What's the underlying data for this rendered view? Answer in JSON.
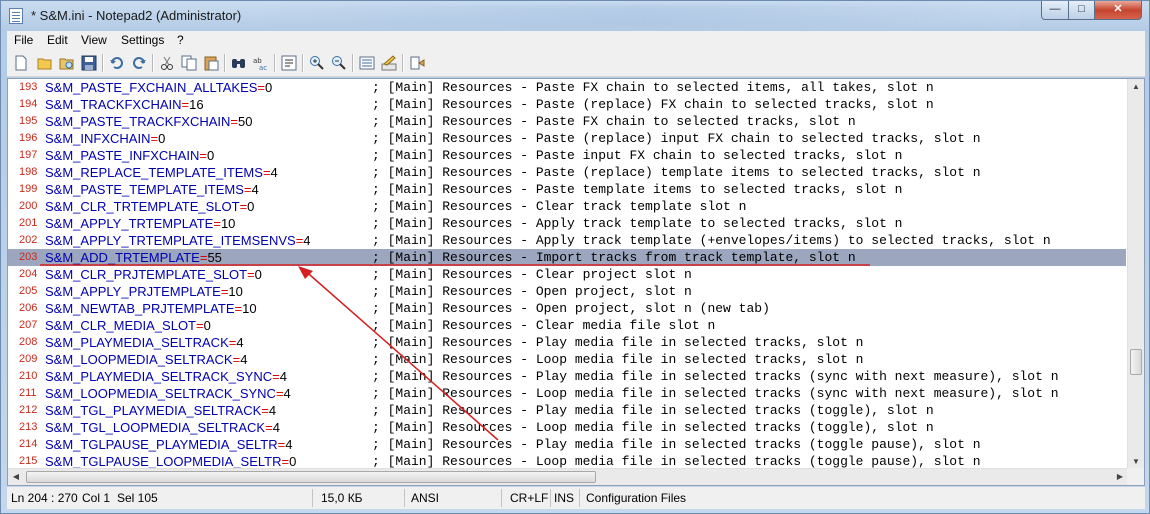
{
  "window": {
    "title": "* S&M.ini - Notepad2 (Administrator)"
  },
  "menu": [
    "File",
    "Edit",
    "View",
    "Settings",
    "?"
  ],
  "toolbar": {
    "buttons": [
      "new-icon",
      "open-icon",
      "browse-icon",
      "save-icon",
      "undo-icon",
      "redo-icon",
      "cut-icon",
      "copy-icon",
      "paste-icon",
      "find-icon",
      "replace-icon",
      "wordwrap-icon",
      "zoom-in-icon",
      "zoom-out-icon",
      "scheme-icon",
      "customize-icon",
      "favorites-icon"
    ]
  },
  "editor": {
    "comment_prefix": ";",
    "lines": [
      {
        "n": "193",
        "key": "S&M_PASTE_FXCHAIN_ALLTAKES",
        "val": "0",
        "comment": "; [Main] Resources - Paste FX chain to selected items, all takes, slot n"
      },
      {
        "n": "194",
        "key": "S&M_TRACKFXCHAIN",
        "val": "16",
        "comment": "; [Main] Resources - Paste (replace) FX chain to selected tracks, slot n"
      },
      {
        "n": "195",
        "key": "S&M_PASTE_TRACKFXCHAIN",
        "val": "50",
        "comment": "; [Main] Resources - Paste FX chain to selected tracks, slot n"
      },
      {
        "n": "196",
        "key": "S&M_INFXCHAIN",
        "val": "0",
        "comment": "; [Main] Resources - Paste (replace) input FX chain to selected tracks, slot n"
      },
      {
        "n": "197",
        "key": "S&M_PASTE_INFXCHAIN",
        "val": "0",
        "comment": "; [Main] Resources - Paste input FX chain to selected tracks, slot n"
      },
      {
        "n": "198",
        "key": "S&M_REPLACE_TEMPLATE_ITEMS",
        "val": "4",
        "comment": "; [Main] Resources - Paste (replace) template items to selected tracks, slot n"
      },
      {
        "n": "199",
        "key": "S&M_PASTE_TEMPLATE_ITEMS",
        "val": "4",
        "comment": "; [Main] Resources - Paste template items to selected tracks, slot n"
      },
      {
        "n": "200",
        "key": "S&M_CLR_TRTEMPLATE_SLOT",
        "val": "0",
        "comment": "; [Main] Resources - Clear track template slot n"
      },
      {
        "n": "201",
        "key": "S&M_APPLY_TRTEMPLATE",
        "val": "10",
        "comment": "; [Main] Resources - Apply track template to selected tracks, slot n"
      },
      {
        "n": "202",
        "key": "S&M_APPLY_TRTEMPLATE_ITEMSENVS",
        "val": "4",
        "comment": "; [Main] Resources - Apply track template (+envelopes/items) to selected tracks, slot n"
      },
      {
        "n": "203",
        "key": "S&M_ADD_TRTEMPLATE",
        "val": "55",
        "comment": "; [Main] Resources - Import tracks from track template, slot n",
        "selected": true
      },
      {
        "n": "204",
        "key": "S&M_CLR_PRJTEMPLATE_SLOT",
        "val": "0",
        "comment": "; [Main] Resources - Clear project slot n"
      },
      {
        "n": "205",
        "key": "S&M_APPLY_PRJTEMPLATE",
        "val": "10",
        "comment": "; [Main] Resources - Open project, slot n"
      },
      {
        "n": "206",
        "key": "S&M_NEWTAB_PRJTEMPLATE",
        "val": "10",
        "comment": "; [Main] Resources - Open project, slot n (new tab)"
      },
      {
        "n": "207",
        "key": "S&M_CLR_MEDIA_SLOT",
        "val": "0",
        "comment": "; [Main] Resources - Clear media file slot n"
      },
      {
        "n": "208",
        "key": "S&M_PLAYMEDIA_SELTRACK",
        "val": "4",
        "comment": "; [Main] Resources - Play media file in selected tracks, slot n"
      },
      {
        "n": "209",
        "key": "S&M_LOOPMEDIA_SELTRACK",
        "val": "4",
        "comment": "; [Main] Resources - Loop media file in selected tracks, slot n"
      },
      {
        "n": "210",
        "key": "S&M_PLAYMEDIA_SELTRACK_SYNC",
        "val": "4",
        "comment": "; [Main] Resources - Play media file in selected tracks (sync with next measure), slot n"
      },
      {
        "n": "211",
        "key": "S&M_LOOPMEDIA_SELTRACK_SYNC",
        "val": "4",
        "comment": "; [Main] Resources - Loop media file in selected tracks (sync with next measure), slot n"
      },
      {
        "n": "212",
        "key": "S&M_TGL_PLAYMEDIA_SELTRACK",
        "val": "4",
        "comment": "; [Main] Resources - Play media file in selected tracks (toggle), slot n"
      },
      {
        "n": "213",
        "key": "S&M_TGL_LOOPMEDIA_SELTRACK",
        "val": "4",
        "comment": "; [Main] Resources - Loop media file in selected tracks (toggle), slot n"
      },
      {
        "n": "214",
        "key": "S&M_TGLPAUSE_PLAYMEDIA_SELTR",
        "val": "4",
        "comment": "; [Main] Resources - Play media file in selected tracks (toggle pause), slot n"
      },
      {
        "n": "215",
        "key": "S&M_TGLPAUSE_LOOPMEDIA_SELTR",
        "val": "0",
        "comment": "; [Main] Resources - Loop media file in selected tracks (toggle pause), slot n"
      }
    ]
  },
  "status": {
    "position": "Ln 204 : 270",
    "column": "Col 1",
    "selection": "Sel 105",
    "size": "15,0 КБ",
    "encoding": "ANSI",
    "eol": "CR+LF",
    "mode": "INS",
    "lexer": "Configuration Files"
  },
  "colors": {
    "selection": "#9ca6bf",
    "annotation": "#d42020",
    "line_numbers": "#c82a1c",
    "keys": "#0000b0"
  }
}
